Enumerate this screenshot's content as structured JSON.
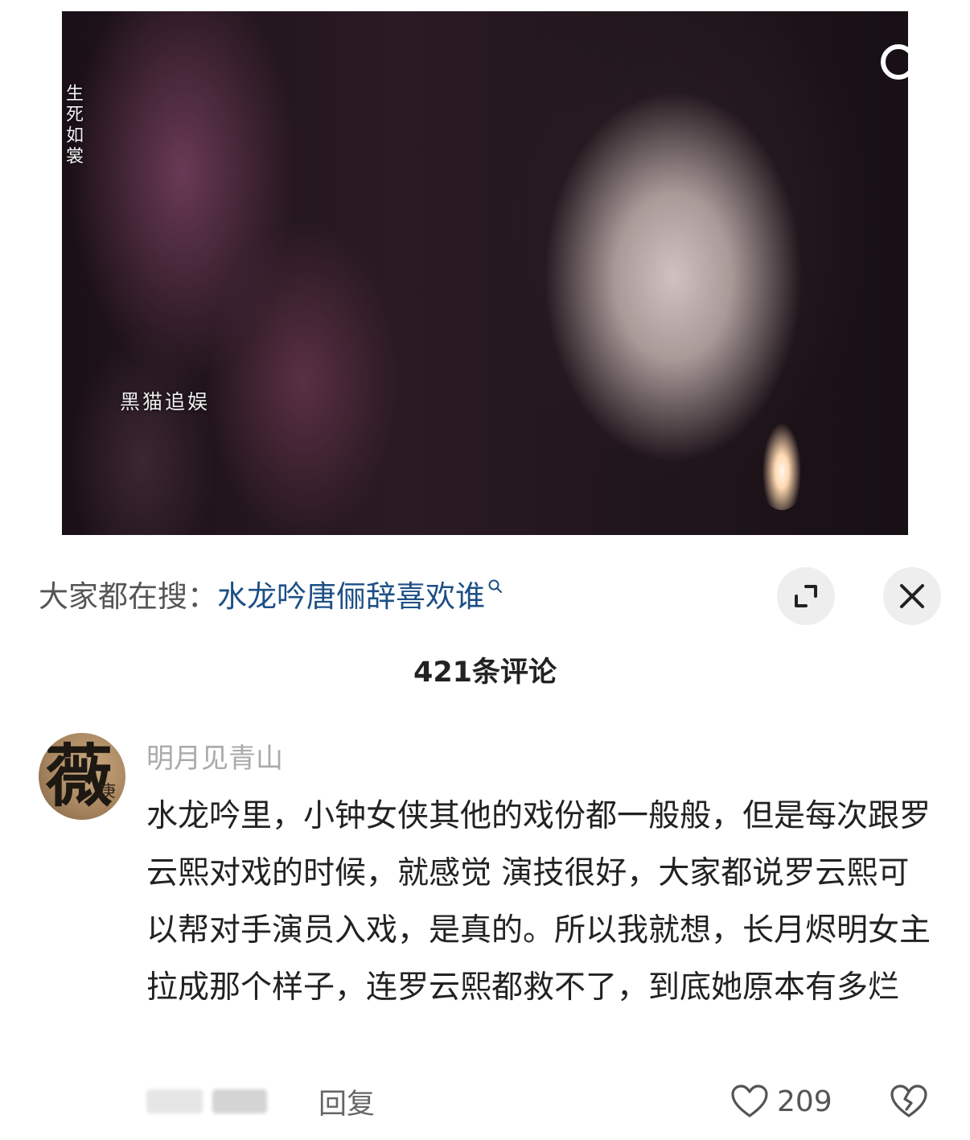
{
  "video": {
    "vertical_title": "生死如裳",
    "watermark": "黑猫追娱",
    "search_icon": "search-icon"
  },
  "sheet": {
    "hot_search_prefix": "大家都在搜：",
    "hot_search_query": "水龙吟唐俪辞喜欢谁",
    "expand_icon": "expand-icon",
    "close_icon": "close-icon",
    "comment_count": "421条评论"
  },
  "comment": {
    "username": "明月见青山",
    "avatar_glyph": "薇",
    "avatar_small": "庚",
    "text": "水龙吟里，小钟女侠其他的戏份都一般般，但是每次跟罗云熙对戏的时候，就感觉 演技很好，大家都说罗云熙可以帮对手演员入戏，是真的。所以我就想，长月烬明女主拉成那个样子，连罗云熙都救不了，到底她原本有多烂",
    "reply_label": "回复",
    "like_count": "209",
    "like_icon": "heart-icon",
    "dislike_icon": "broken-heart-icon"
  },
  "colors": {
    "link": "#1d4f86",
    "text": "#222222",
    "muted": "#aaaaaa",
    "button_bg": "#eeeeee"
  }
}
